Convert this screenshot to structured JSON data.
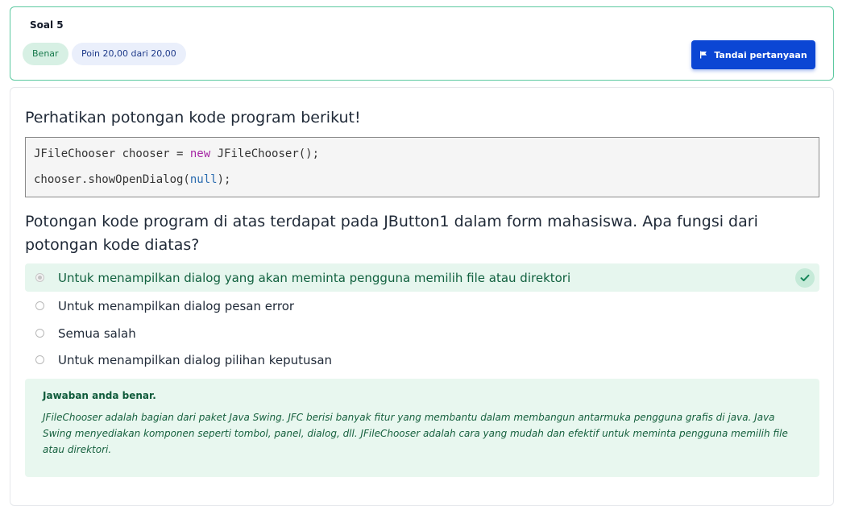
{
  "header": {
    "title": "Soal 5",
    "status_badge": "Benar",
    "points_badge": "Poin 20,00 dari 20,00",
    "flag_button_label": "Tandai pertanyaan"
  },
  "question": {
    "prompt": "Perhatikan potongan kode program berikut!",
    "code": {
      "line1_a": "JFileChooser chooser = ",
      "line1_kw": "new",
      "line1_b": " JFileChooser();",
      "line2_a": "chooser.showOpenDialog(",
      "line2_kw": "null",
      "line2_b": ");"
    },
    "text": "Potongan kode program di atas terdapat pada JButton1 dalam form mahasiswa. Apa fungsi dari potongan kode diatas?"
  },
  "options": [
    {
      "label": "Untuk menampilkan dialog yang akan meminta pengguna memilih file atau direktori",
      "selected": true,
      "correct": true
    },
    {
      "label": "Untuk menampilkan dialog pesan error",
      "selected": false
    },
    {
      "label": "Semua salah",
      "selected": false
    },
    {
      "label": "Untuk menampilkan dialog pilihan keputusan",
      "selected": false
    }
  ],
  "feedback": {
    "title": "Jawaban anda benar.",
    "text": "JFileChooser adalah bagian dari paket Java Swing. JFC berisi banyak fitur yang membantu dalam membangun antarmuka pengguna grafis di java. Java Swing menyediakan komponen seperti tombol, panel, dialog, dll. JFileChooser adalah cara yang mudah dan efektif untuk meminta pengguna memilih file atau direktori."
  },
  "icons": {
    "flag": "flag-icon",
    "check": "check-icon"
  },
  "colors": {
    "accent": "#0b46d4",
    "correct_border": "#5cc9a0",
    "correct_bg": "#e6f6ee",
    "correct_text": "#177a4c"
  }
}
